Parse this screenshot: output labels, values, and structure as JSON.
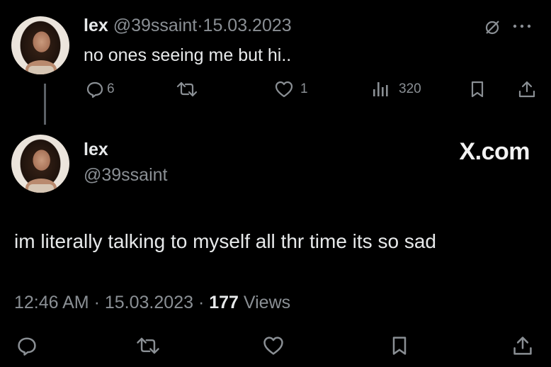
{
  "tweet1": {
    "name": "lex",
    "handle": "@39ssaint",
    "separator": "·",
    "date": "15.03.2023",
    "text": "no ones seeing me but hi..",
    "replies": "6",
    "likes": "1",
    "views": "320",
    "icons": [
      "edit-slash-icon",
      "more-icon",
      "reply-icon",
      "retweet-icon",
      "like-icon",
      "views-icon",
      "bookmark-icon",
      "share-icon"
    ]
  },
  "tweet2": {
    "name": "lex",
    "handle": "@39ssaint",
    "watermark": "X.com",
    "text": "im literally talking to myself all thr time its so sad",
    "time": "12:46 AM",
    "separator": "·",
    "date": "15.03.2023",
    "views_count": "177",
    "views_label": "Views",
    "icons": [
      "reply-icon",
      "retweet-icon",
      "like-icon",
      "bookmark-icon",
      "share-icon"
    ]
  },
  "colors": {
    "background": "#000000",
    "text_primary": "#e7e9ea",
    "text_secondary": "#8a8f94",
    "thread_line": "#5b6066"
  }
}
